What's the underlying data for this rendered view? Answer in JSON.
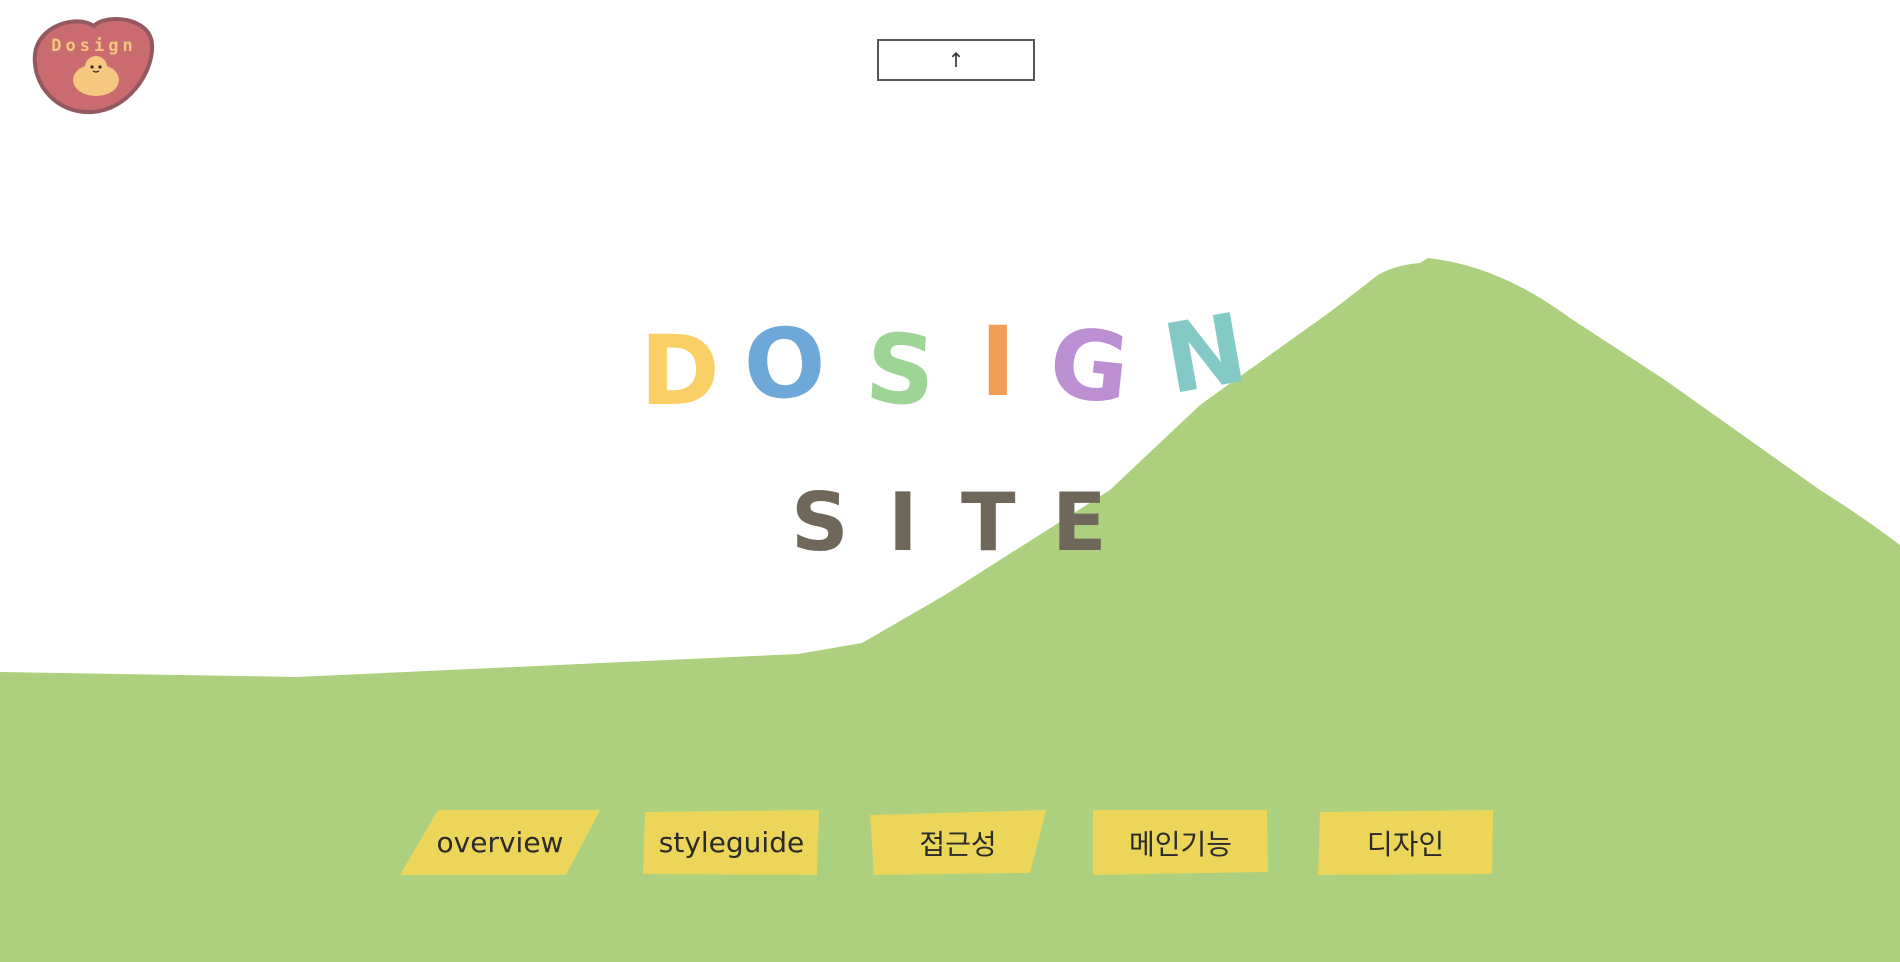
{
  "logo": {
    "text": "Dosign",
    "colors": {
      "heart": "#c96b6f",
      "heart_border": "#94595f",
      "chick": "#f6c77e"
    }
  },
  "top_button": {
    "icon": "arrow-up-icon",
    "glyph": "↑"
  },
  "hero": {
    "title_letters": [
      {
        "char": "D",
        "color": "#f9cf66"
      },
      {
        "char": "O",
        "color": "#6ea8d8"
      },
      {
        "char": "S",
        "color": "#9fd497"
      },
      {
        "char": "I",
        "color": "#f39c55"
      },
      {
        "char": "G",
        "color": "#bb8fd1"
      },
      {
        "char": "N",
        "color": "#83c9c6"
      }
    ],
    "subtitle_letters": [
      "S",
      "I",
      "T",
      "E"
    ],
    "subtitle_color": "#6f6759"
  },
  "colors": {
    "hill": "#add07e",
    "nav_bg": "#ecd65a"
  },
  "nav": {
    "items": [
      {
        "label": "overview"
      },
      {
        "label": "styleguide"
      },
      {
        "label": "접근성"
      },
      {
        "label": "메인기능"
      },
      {
        "label": "디자인"
      }
    ]
  }
}
